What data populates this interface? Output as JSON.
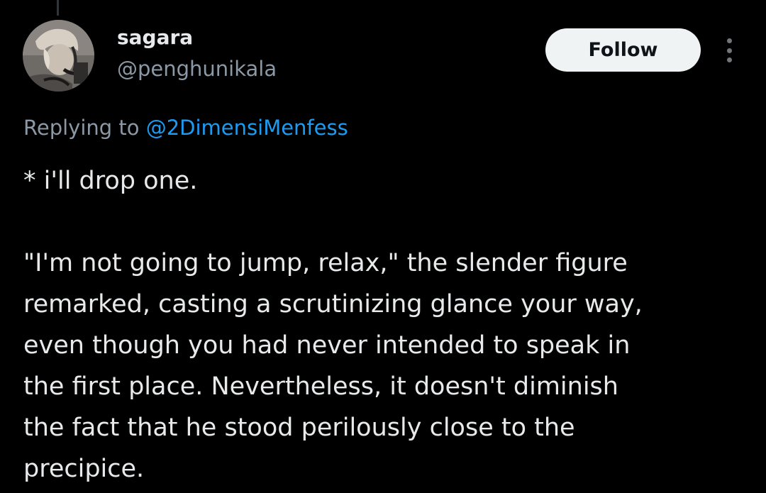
{
  "author": {
    "display_name": "sagara",
    "handle": "@penghunikala"
  },
  "actions": {
    "follow_label": "Follow",
    "more_icon": "more-vertical-icon"
  },
  "reply": {
    "prefix": "Replying to",
    "mention": "@2DimensiMenfess"
  },
  "tweet": {
    "lines": [
      "* i'll drop one.",
      "",
      "\"I'm not going to jump, relax,\" the slender figure",
      "remarked, casting a scrutinizing glance your way,",
      "even though you had never intended to speak in",
      "the first place. Nevertheless, it doesn't diminish",
      "the fact that he stood perilously close to the",
      "precipice."
    ]
  },
  "colors": {
    "background": "#000000",
    "primary_text": "#e7e9ea",
    "secondary_text": "#8b98a5",
    "link": "#1d9bf0",
    "follow_bg": "#eff3f4"
  }
}
